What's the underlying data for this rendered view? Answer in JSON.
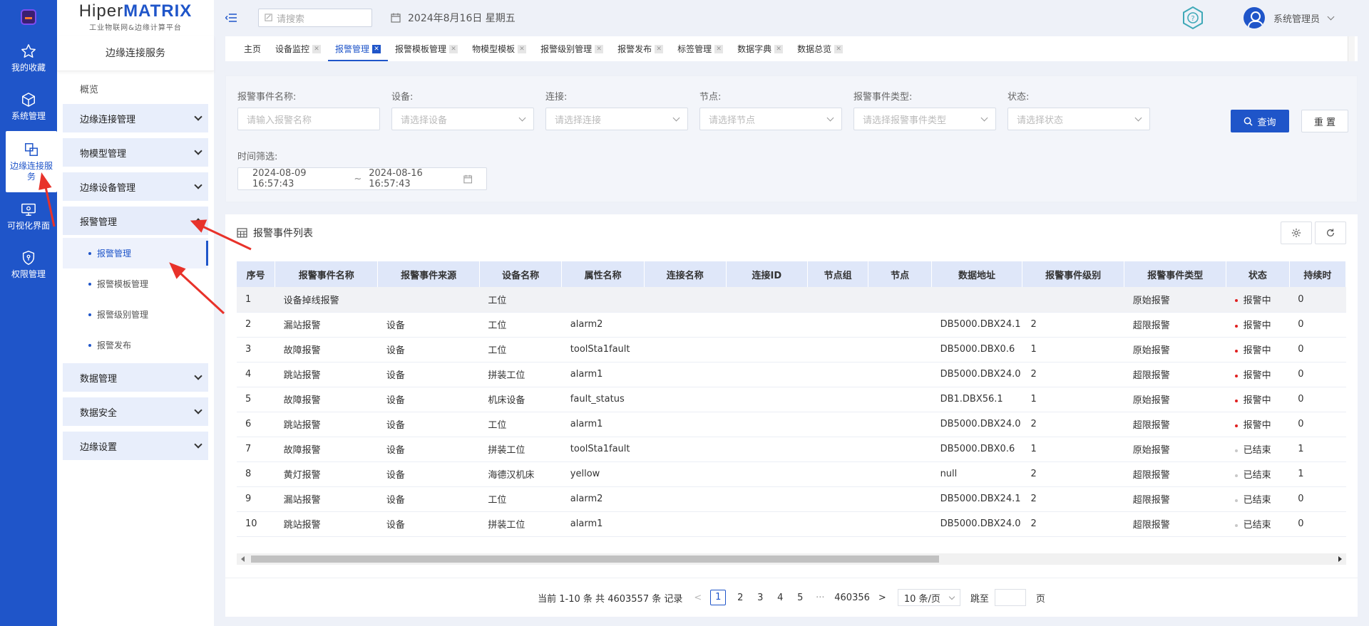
{
  "rail": {
    "items": [
      {
        "label": "我的收藏",
        "icon": "star-icon"
      },
      {
        "label": "系统管理",
        "icon": "cube-icon"
      },
      {
        "label": "边缘连接服务",
        "icon": "copy-icon"
      },
      {
        "label": "可视化界面",
        "icon": "monitor-icon"
      },
      {
        "label": "权限管理",
        "icon": "shield-icon"
      }
    ]
  },
  "brand": {
    "part1": "Hiper",
    "part2": "MATRIX",
    "subtitle": "工业物联网&边缘计算平台"
  },
  "sidebar": {
    "title": "边缘连接服务",
    "overview": "概览",
    "groups_top": [
      "边缘连接管理",
      "物模型管理",
      "边缘设备管理"
    ],
    "open_group": "报警管理",
    "sub_items": [
      "报警管理",
      "报警模板管理",
      "报警级别管理",
      "报警发布"
    ],
    "groups_bottom": [
      "数据管理",
      "数据安全",
      "边缘设置"
    ]
  },
  "topbar": {
    "search_placeholder": "请搜索",
    "date": "2024年8月16日 星期五",
    "user": "系统管理员"
  },
  "tabs": [
    "主页",
    "设备监控",
    "报警管理",
    "报警模板管理",
    "物模型模板",
    "报警级别管理",
    "报警发布",
    "标签管理",
    "数据字典",
    "数据总览"
  ],
  "filter": {
    "name_label": "报警事件名称:",
    "name_placeholder": "请输入报警名称",
    "device_label": "设备:",
    "device_placeholder": "请选择设备",
    "conn_label": "连接:",
    "conn_placeholder": "请选择连接",
    "node_label": "节点:",
    "node_placeholder": "请选择节点",
    "type_label": "报警事件类型:",
    "type_placeholder": "请选择报警事件类型",
    "status_label": "状态:",
    "status_placeholder": "请选择状态",
    "time_label": "时间筛选:",
    "time_start": "2024-08-09 16:57:43",
    "time_sep": "~",
    "time_end": "2024-08-16 16:57:43",
    "query_button": "查询",
    "reset_button": "重 置"
  },
  "list": {
    "title": "报警事件列表",
    "columns": [
      "序号",
      "报警事件名称",
      "报警事件来源",
      "设备名称",
      "属性名称",
      "连接名称",
      "连接ID",
      "节点组",
      "节点",
      "数据地址",
      "报警事件级别",
      "报警事件类型",
      "状态",
      "持续时"
    ],
    "rows": [
      [
        "1",
        "设备掉线报警",
        "",
        "工位",
        "",
        "",
        "",
        "",
        "",
        "",
        "",
        "原始报警",
        "报警中",
        "0"
      ],
      [
        "2",
        "漏站报警",
        "设备",
        "工位",
        "alarm2",
        "",
        "",
        "",
        "",
        "DB5000.DBX24.1",
        "2",
        "超限报警",
        "报警中",
        "0"
      ],
      [
        "3",
        "故障报警",
        "设备",
        "工位",
        "toolSta1fault",
        "",
        "",
        "",
        "",
        "DB5000.DBX0.6",
        "1",
        "原始报警",
        "报警中",
        "0"
      ],
      [
        "4",
        "跳站报警",
        "设备",
        "拼装工位",
        "alarm1",
        "",
        "",
        "",
        "",
        "DB5000.DBX24.0",
        "2",
        "超限报警",
        "报警中",
        "0"
      ],
      [
        "5",
        "故障报警",
        "设备",
        "机床设备",
        "fault_status",
        "",
        "",
        "",
        "",
        "DB1.DBX56.1",
        "1",
        "原始报警",
        "报警中",
        "0"
      ],
      [
        "6",
        "跳站报警",
        "设备",
        "工位",
        "alarm1",
        "",
        "",
        "",
        "",
        "DB5000.DBX24.0",
        "2",
        "超限报警",
        "报警中",
        "0"
      ],
      [
        "7",
        "故障报警",
        "设备",
        "拼装工位",
        "toolSta1fault",
        "",
        "",
        "",
        "",
        "DB5000.DBX0.6",
        "1",
        "原始报警",
        "已结束",
        "1"
      ],
      [
        "8",
        "黄灯报警",
        "设备",
        "海德汉机床",
        "yellow",
        "",
        "",
        "",
        "",
        "null",
        "2",
        "超限报警",
        "已结束",
        "1"
      ],
      [
        "9",
        "漏站报警",
        "设备",
        "工位",
        "alarm2",
        "",
        "",
        "",
        "",
        "DB5000.DBX24.1",
        "2",
        "超限报警",
        "已结束",
        "0"
      ],
      [
        "10",
        "跳站报警",
        "设备",
        "拼装工位",
        "alarm1",
        "",
        "",
        "",
        "",
        "DB5000.DBX24.0",
        "2",
        "超限报警",
        "已结束",
        "0"
      ]
    ],
    "status_colors": {
      "报警中": "#e02020",
      "已结束": "#c8c8c8"
    }
  },
  "pager": {
    "summary": "当前 1-10 条 共 4603557 条 记录",
    "prev": "<",
    "pages": [
      "1",
      "2",
      "3",
      "4",
      "5"
    ],
    "ellipsis": "···",
    "last": "460356",
    "next": ">",
    "page_size": "10 条/页",
    "jump_label": "跳至",
    "page_unit": "页"
  },
  "colors": {
    "primary": "#1f55c9",
    "annotation": "#e8322a"
  }
}
